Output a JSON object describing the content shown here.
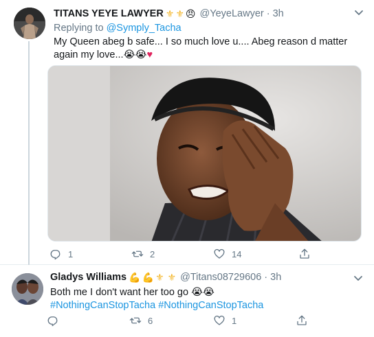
{
  "tweet1": {
    "name": "TITANS YEYE LAWYER",
    "name_emojis": [
      "⚜",
      "⚜",
      "😠"
    ],
    "handle": "@YeyeLawyer",
    "dot": "·",
    "time": "3h",
    "reply_prefix": "Replying to",
    "reply_mention": "@Symply_Tacha",
    "text": "My Queen abeg b safe... I so much love u.... Abeg reason d matter again my love...",
    "text_emojis": "😭😭",
    "text_heart": "♥",
    "media_alt": "crying-man-photo",
    "stats": {
      "reply": "1",
      "retweet": "2",
      "like": "14"
    }
  },
  "tweet2": {
    "name": "Gladys Williams",
    "name_emojis": [
      "💪",
      "💪",
      "⚜",
      "⚜"
    ],
    "handle": "@Titans08729606",
    "dot": "·",
    "time": "3h",
    "text": "Both me I don't want her too go",
    "text_emojis": "😭😭",
    "hashtag1": "#NothingCanStopTacha",
    "hashtag2": "#NothingCanStopTacha",
    "stats": {
      "reply": "",
      "retweet": "6",
      "like": "1"
    }
  },
  "colors": {
    "link": "#1b95e0",
    "muted": "#657786",
    "text": "#14171a",
    "heart": "#e0245e",
    "emoji_gold": "#f3b526"
  },
  "icons": {
    "reply": "reply-icon",
    "retweet": "retweet-icon",
    "like": "like-icon",
    "share": "share-icon",
    "caret": "chevron-down-icon"
  }
}
